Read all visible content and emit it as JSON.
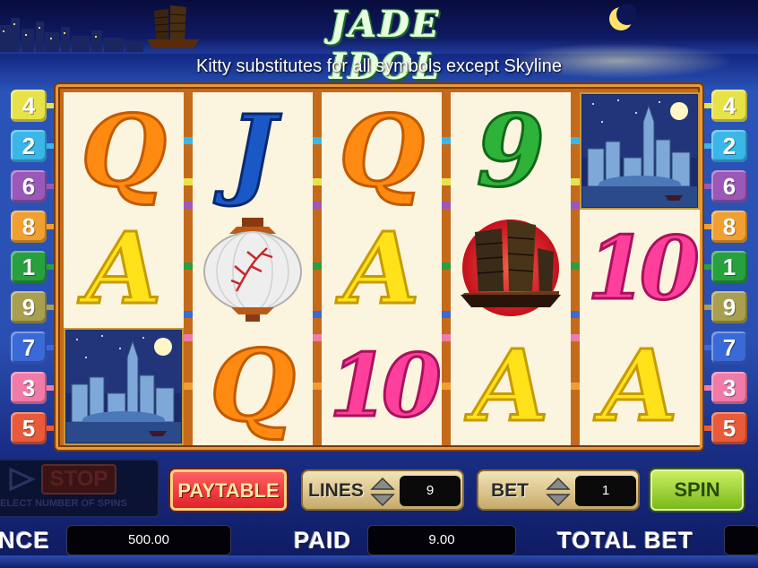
{
  "header": {
    "logo_text": "JADE IDOL",
    "message": "Kitty substitutes for all symbols except Skyline"
  },
  "paylines": {
    "left": [
      {
        "label": "4",
        "color": "#e8e24a"
      },
      {
        "label": "2",
        "color": "#3ab6e8"
      },
      {
        "label": "6",
        "color": "#9a58b8"
      },
      {
        "label": "8",
        "color": "#f0a030"
      },
      {
        "label": "1",
        "color": "#28a040"
      },
      {
        "label": "9",
        "color": "#a8a050"
      },
      {
        "label": "7",
        "color": "#3a6ad8"
      },
      {
        "label": "3",
        "color": "#f07aa8"
      },
      {
        "label": "5",
        "color": "#e85a3a"
      }
    ],
    "right": [
      {
        "label": "4",
        "color": "#e8e24a"
      },
      {
        "label": "2",
        "color": "#3ab6e8"
      },
      {
        "label": "6",
        "color": "#9a58b8"
      },
      {
        "label": "8",
        "color": "#f0a030"
      },
      {
        "label": "1",
        "color": "#28a040"
      },
      {
        "label": "9",
        "color": "#a8a050"
      },
      {
        "label": "7",
        "color": "#3a6ad8"
      },
      {
        "label": "3",
        "color": "#f07aa8"
      },
      {
        "label": "5",
        "color": "#e85a3a"
      }
    ]
  },
  "reels": [
    [
      "Q",
      "A",
      "skyline"
    ],
    [
      "J",
      "lantern",
      "Q"
    ],
    [
      "Q",
      "A",
      "10"
    ],
    [
      "9",
      "junk-ship",
      "A"
    ],
    [
      "skyline",
      "10",
      "A"
    ]
  ],
  "controls": {
    "stop_label": "STOP",
    "select_spins_text": "ELECT NUMBER OF SPINS",
    "paytable_label": "PAYTABLE",
    "lines_label": "LINES",
    "lines_value": "9",
    "bet_label": "BET",
    "bet_value": "1",
    "spin_label": "SPIN"
  },
  "readouts": {
    "balance_label": "NCE",
    "balance_value": "500.00",
    "paid_label": "PAID",
    "paid_value": "9.00",
    "total_bet_label": "TOTAL BET",
    "total_bet_value": ""
  }
}
